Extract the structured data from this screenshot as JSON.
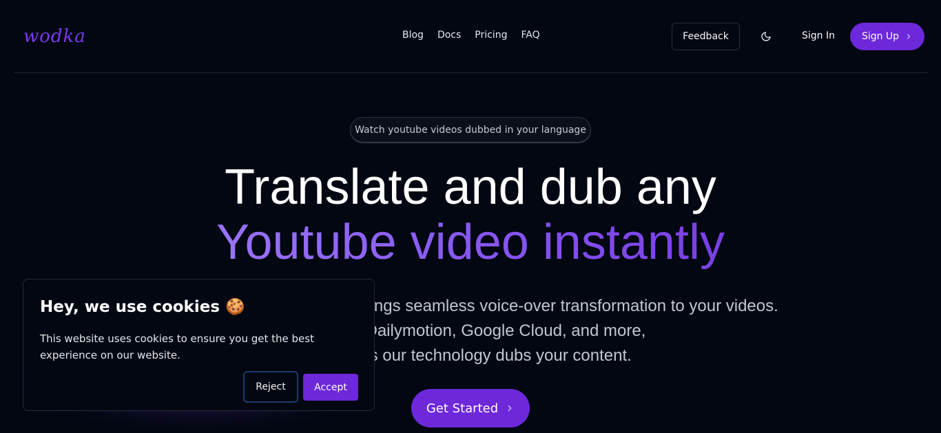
{
  "header": {
    "logo": "wodka",
    "nav": [
      {
        "label": "Blog"
      },
      {
        "label": "Docs"
      },
      {
        "label": "Pricing"
      },
      {
        "label": "FAQ"
      }
    ],
    "feedback_label": "Feedback",
    "theme_icon": "moon-icon",
    "signin_label": "Sign In",
    "signup_label": "Sign Up"
  },
  "hero": {
    "pill": "Watch youtube videos dubbed in your language",
    "title_line1": "Translate and dub any",
    "title_line2": "Youtube video instantly",
    "subtitle_lines": [
      "brings seamless voice-over transformation to your videos.",
      "ouTube, Dailymotion, Google Cloud, and more,",
      "nagic as our technology dubs your content."
    ],
    "cta_label": "Get Started"
  },
  "cookie": {
    "title": "Hey, we use cookies 🍪",
    "text": "This website uses cookies to ensure you get the best experience on our website.",
    "reject_label": "Reject",
    "accept_label": "Accept"
  },
  "colors": {
    "background": "#030712",
    "accent": "#6d28d9",
    "gradient_start": "#a78bfa",
    "gradient_end": "#6d28d9"
  }
}
